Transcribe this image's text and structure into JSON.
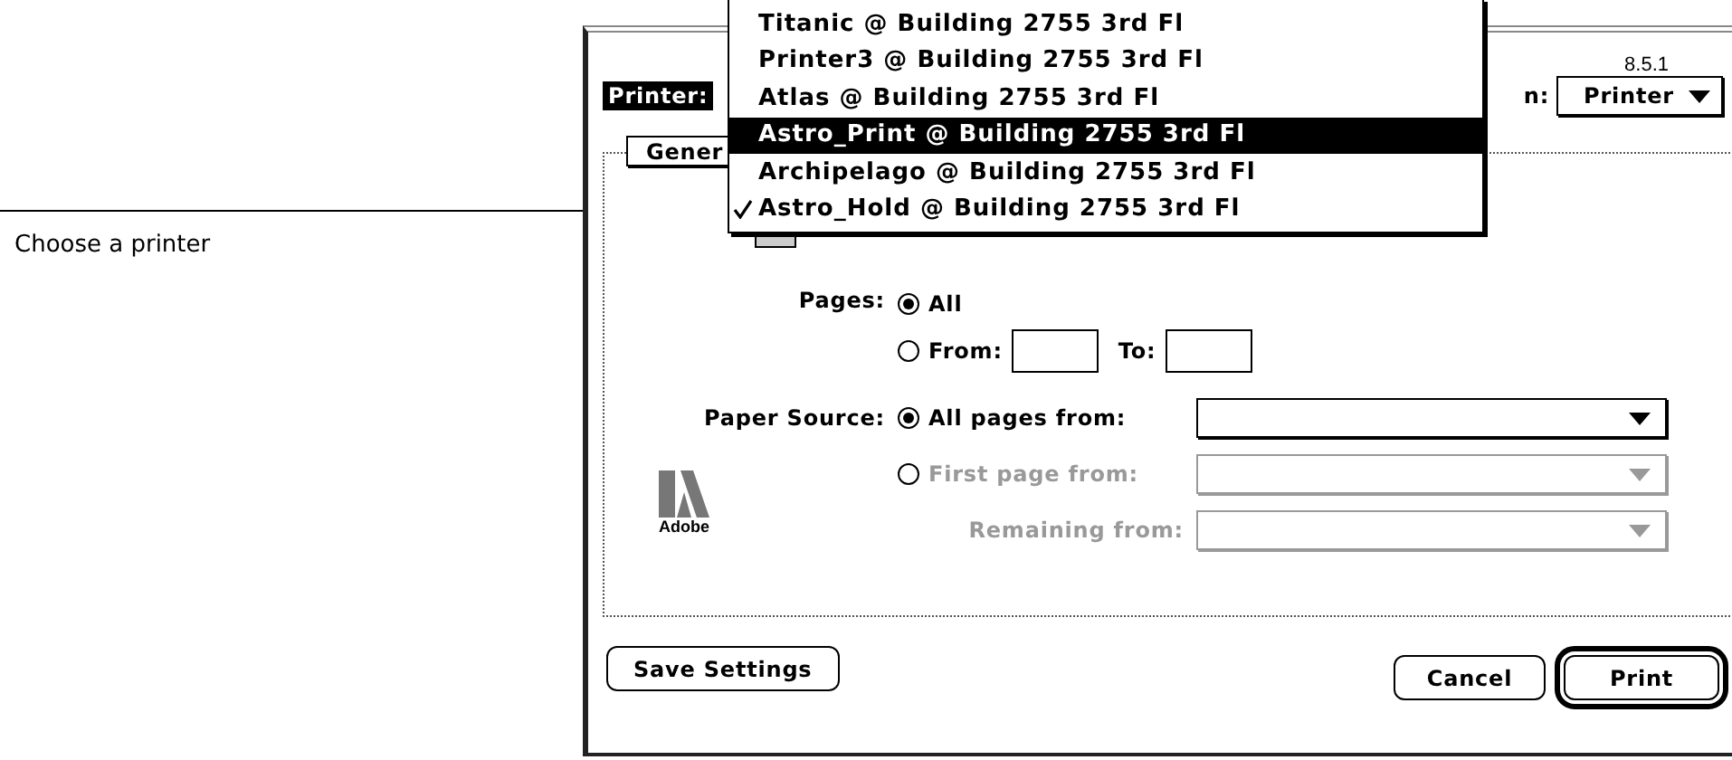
{
  "callout": {
    "label": "Choose a printer"
  },
  "version": "8.5.1",
  "printer_label": "Printer:",
  "printer_menu": {
    "items": [
      {
        "label": "Titanic @ Building 2755 3rd Fl",
        "highlighted": false,
        "checked": false
      },
      {
        "label": "Printer3 @ Building 2755 3rd Fl",
        "highlighted": false,
        "checked": false
      },
      {
        "label": "Atlas @ Building 2755 3rd Fl",
        "highlighted": false,
        "checked": false
      },
      {
        "label": "Astro_Print @ Building 2755 3rd Fl",
        "highlighted": true,
        "checked": false
      },
      {
        "label": "Archipelago @ Building 2755 3rd Fl",
        "highlighted": false,
        "checked": false
      },
      {
        "label": "Astro_Hold @ Building 2755 3rd Fl",
        "highlighted": false,
        "checked": true
      }
    ]
  },
  "destination": {
    "label": "n:",
    "value": "Printer"
  },
  "tabs": [
    {
      "label": "Gener",
      "selected": true
    }
  ],
  "pages": {
    "label": "Pages:",
    "options": [
      {
        "kind": "all",
        "label": "All",
        "selected": true
      },
      {
        "kind": "range",
        "label": "From:",
        "selected": false,
        "to_label": "To:"
      }
    ]
  },
  "paper_source": {
    "label": "Paper Source:",
    "options": [
      {
        "label": "All pages from:",
        "selected": true,
        "disabled": false
      },
      {
        "label": "First page from:",
        "selected": false,
        "disabled": true
      }
    ],
    "remaining": {
      "label": "Remaining from:",
      "disabled": true
    }
  },
  "logo": {
    "text": "Adobe"
  },
  "buttons": {
    "left": [
      {
        "label": "Save Settings",
        "default": false
      }
    ],
    "right": [
      {
        "label": "Cancel",
        "default": false
      },
      {
        "label": "Print",
        "default": true
      }
    ]
  }
}
